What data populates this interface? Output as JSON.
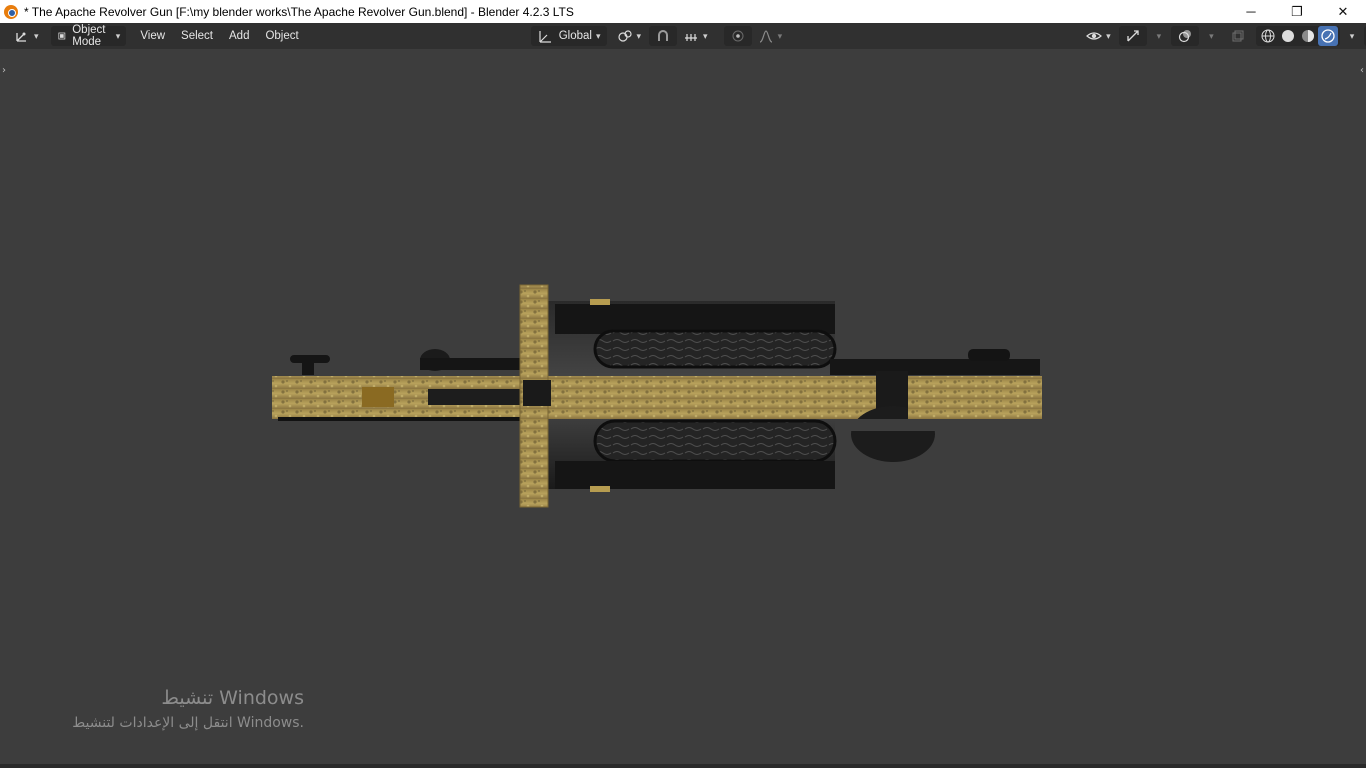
{
  "window": {
    "title": "* The Apache Revolver Gun [F:\\my blender works\\The Apache Revolver Gun.blend] - Blender 4.2.3 LTS",
    "controls": {
      "minimize": "─",
      "maximize": "❐",
      "close": "✕"
    }
  },
  "header": {
    "mode_label": "Object Mode",
    "menus": [
      "View",
      "Select",
      "Add",
      "Object"
    ],
    "orientation_label": "Global"
  },
  "watermark": {
    "line1": "تنشيط Windows",
    "line2": "انتقل إلى الإعدادات لتنشيط Windows."
  },
  "colors": {
    "viewport_bg": "#3d3d3d",
    "header_bg": "#303030",
    "active_blue": "#4772b3",
    "brass": "#b59a4e",
    "gunmetal": "#1e1e1e"
  }
}
